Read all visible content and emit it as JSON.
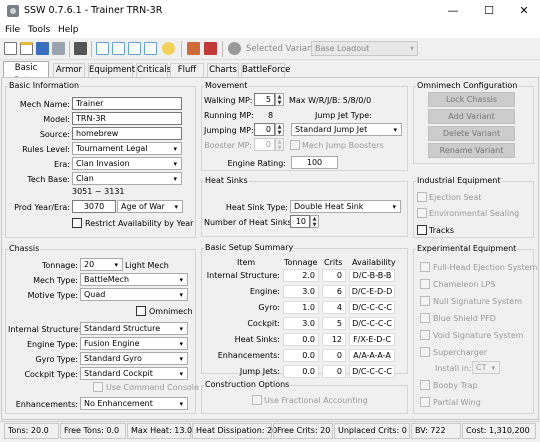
{
  "window": {
    "title": "SSW 0.7.6.1 - Trainer TRN-3R",
    "minimize": "—",
    "maximize": "☐",
    "close": "✕"
  },
  "menu": [
    "File",
    "Tools",
    "Help"
  ],
  "toolbar": {
    "variant_label": "Selected Variant:",
    "variant_value": "Base Loadout"
  },
  "tabs": [
    "Basic Setup",
    "Armor",
    "Equipment",
    "Criticals",
    "Fluff",
    "Charts",
    "BattleForce"
  ],
  "basic_info": {
    "title": "Basic Information",
    "mech_name_label": "Mech Name:",
    "mech_name": "Trainer",
    "model_label": "Model:",
    "model": "TRN-3R",
    "source_label": "Source:",
    "source": "homebrew",
    "rules_label": "Rules Level:",
    "rules": "Tournament Legal",
    "era_label": "Era:",
    "era": "Clan Invasion",
    "techbase_label": "Tech Base:",
    "techbase": "Clan",
    "year_range": "3051 ~ 3131",
    "prod_label": "Prod Year/Era:",
    "prod_year": "3070",
    "prod_era": "Age of War",
    "restrict_label": "Restrict Availability by Year"
  },
  "chassis": {
    "title": "Chassis",
    "tonnage_label": "Tonnage:",
    "tonnage": "20",
    "weight_class": "Light Mech",
    "mech_type_label": "Mech Type:",
    "mech_type": "BattleMech",
    "motive_label": "Motive Type:",
    "motive": "Quad",
    "omnimech_label": "Omnimech",
    "structure_label": "Internal Structure:",
    "structure": "Standard Structure",
    "engine_label": "Engine Type:",
    "engine": "Fusion Engine",
    "gyro_label": "Gyro Type:",
    "gyro": "Standard Gyro",
    "cockpit_label": "Cockpit Type:",
    "cockpit": "Standard Cockpit",
    "console_label": "Use Command Console",
    "enh_label": "Enhancements:",
    "enh": "No Enhancement"
  },
  "movement": {
    "title": "Movement",
    "walk_label": "Walking MP:",
    "walk": "5",
    "wrjb": "Max W/R/J/B: 5/8/0/0",
    "run_label": "Running MP:",
    "run": "8",
    "jjtype_label": "Jump Jet Type:",
    "jump_label": "Jumping MP:",
    "jump": "0",
    "jjtype": "Standard Jump Jet",
    "booster_label": "Booster MP:",
    "booster": "0",
    "mjb_label": "Mech Jump Boosters",
    "rating_label": "Engine Rating:",
    "rating": "100"
  },
  "heatsinks": {
    "title": "Heat Sinks",
    "type_label": "Heat Sink Type:",
    "type": "Double Heat Sink",
    "count_label": "Number of Heat Sinks:",
    "count": "10"
  },
  "summary": {
    "title": "Basic Setup Summary",
    "headers": [
      "Item",
      "Tonnage",
      "Crits",
      "Availability"
    ],
    "rows": [
      [
        "Internal Structure:",
        "2.0",
        "0",
        "D/C-B-B-B"
      ],
      [
        "Engine:",
        "3.0",
        "6",
        "D/C-E-D-D"
      ],
      [
        "Gyro:",
        "1.0",
        "4",
        "D/C-C-C-C"
      ],
      [
        "Cockpit:",
        "3.0",
        "5",
        "D/C-C-C-C"
      ],
      [
        "Heat Sinks:",
        "0.0",
        "12",
        "F/X-E-D-C"
      ],
      [
        "Enhancements:",
        "0.0",
        "0",
        "A/A-A-A-A"
      ],
      [
        "Jump Jets:",
        "0.0",
        "0",
        "D/C-C-C-C"
      ]
    ]
  },
  "construction": {
    "title": "Construction Options",
    "frac_label": "Use Fractional Accounting"
  },
  "omni": {
    "title": "Omnimech Configuration",
    "buttons": [
      "Lock Chassis",
      "Add Variant",
      "Delete Variant",
      "Rename Variant"
    ]
  },
  "industrial": {
    "title": "Industrial Equipment",
    "items": [
      "Ejection Seat",
      "Environmental Sealing",
      "Tracks"
    ]
  },
  "experimental": {
    "title": "Experimental Equipment",
    "items": [
      "Full-Head Ejection System",
      "Chameleon LPS",
      "Null Signature System",
      "Blue Shield PFD",
      "Void Signature System",
      "Supercharger"
    ],
    "install_label": "Install in:",
    "install_value": "CT",
    "items2": [
      "Booby Trap",
      "Partial Wing"
    ]
  },
  "status": [
    "Tons: 20.0",
    "Free Tons: 0.0",
    "Max Heat: 13.0",
    "Heat Dissipation: 20",
    "Free Crits: 20",
    "Unplaced Crits: 0",
    "BV: 722",
    "Cost: 1,310,200"
  ]
}
